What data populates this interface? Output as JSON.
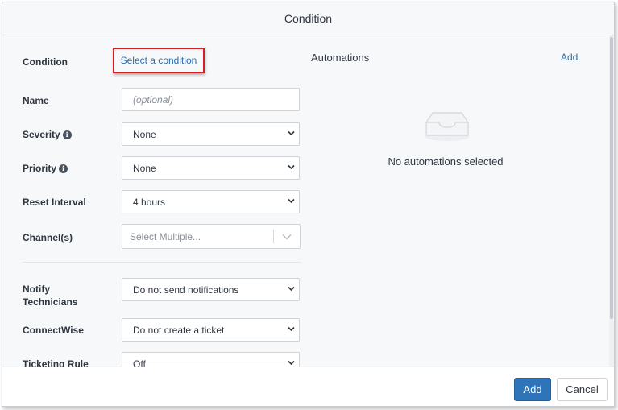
{
  "dialog": {
    "title": "Condition"
  },
  "form": {
    "condition": {
      "label": "Condition",
      "link_text": "Select a condition"
    },
    "name": {
      "label": "Name",
      "placeholder": "(optional)"
    },
    "severity": {
      "label": "Severity",
      "value": "None"
    },
    "priority": {
      "label": "Priority",
      "value": "None"
    },
    "reset_interval": {
      "label": "Reset Interval",
      "value": "4 hours"
    },
    "channels": {
      "label": "Channel(s)",
      "placeholder": "Select Multiple..."
    },
    "notify": {
      "label_line1": "Notify",
      "label_line2": "Technicians",
      "value": "Do not send notifications"
    },
    "connectwise": {
      "label": "ConnectWise",
      "value": "Do not create a ticket"
    },
    "ticketing_rule": {
      "label": "Ticketing Rule",
      "value": "Off"
    }
  },
  "automations": {
    "title": "Automations",
    "add_label": "Add",
    "empty_text": "No automations selected"
  },
  "footer": {
    "primary_label": "Add",
    "secondary_label": "Cancel"
  },
  "colors": {
    "accent": "#2e74b9",
    "link": "#2d6ea8",
    "highlight_border": "#d21f24"
  },
  "icons": {
    "info": "info-icon",
    "dropdown": "chevron-down-icon",
    "empty": "empty-inbox-icon"
  }
}
